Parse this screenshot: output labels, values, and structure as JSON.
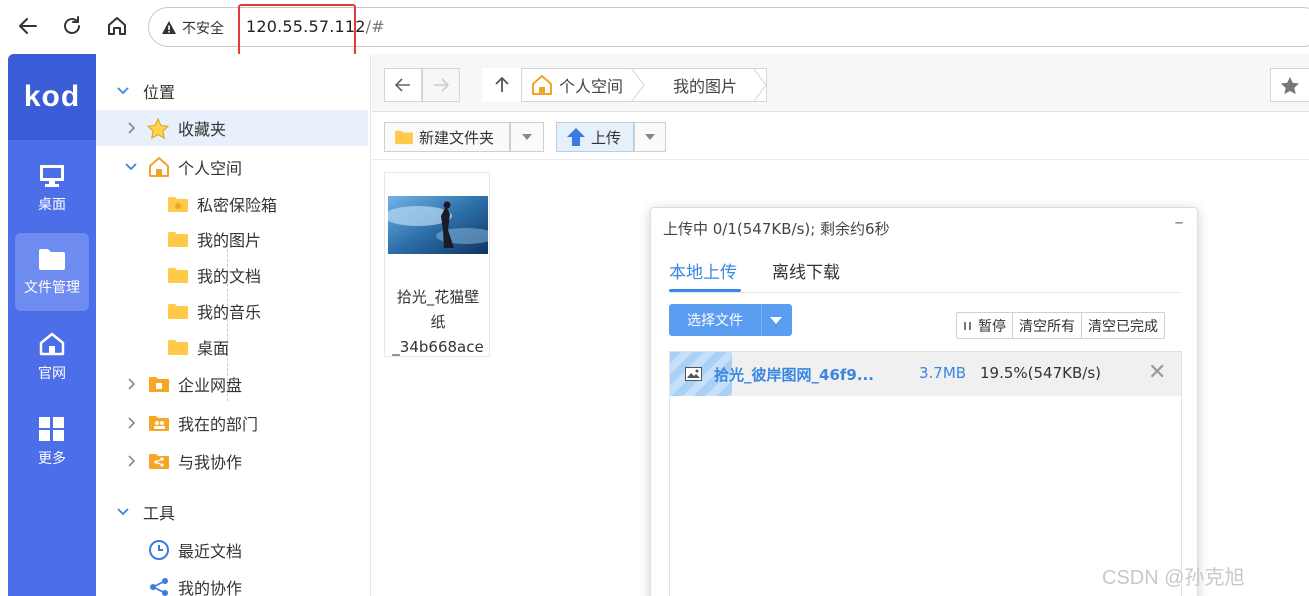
{
  "browser": {
    "insecure_label": "不安全",
    "url_host": "120.55.57.112",
    "url_suffix": "/#"
  },
  "rail": {
    "logo": "kod",
    "items": [
      {
        "label": "桌面",
        "icon": "monitor-icon"
      },
      {
        "label": "文件管理",
        "icon": "folder-icon",
        "active": true
      },
      {
        "label": "官网",
        "icon": "home-icon"
      },
      {
        "label": "更多",
        "icon": "grid-icon"
      }
    ]
  },
  "tree": {
    "section_location": "位置",
    "favorites": "收藏夹",
    "personal_space": "个人空间",
    "children": [
      "私密保险箱",
      "我的图片",
      "我的文档",
      "我的音乐",
      "桌面"
    ],
    "enterprise_disk": "企业网盘",
    "my_department": "我在的部门",
    "collaborate_with_me": "与我协作",
    "section_tools": "工具",
    "recent_docs": "最近文档",
    "my_collab": "我的协作"
  },
  "main": {
    "breadcrumb": [
      "个人空间",
      "我的图片"
    ],
    "new_folder": "新建文件夹",
    "upload": "上传",
    "file": {
      "name_lines": [
        "拾光_花猫壁",
        "纸",
        "_34b668ace"
      ]
    }
  },
  "dialog": {
    "title": "上传中 0/1(547KB/s); 剩余约6秒",
    "minimize": "–",
    "tab_local": "本地上传",
    "tab_offline": "离线下载",
    "select_file": "选择文件",
    "pause": "暂停",
    "clear_all": "清空所有",
    "clear_done": "清空已完成",
    "item": {
      "name": "拾光_彼岸图网_46f9...",
      "size": "3.7MB",
      "progress_text": "19.5%(547KB/s)",
      "progress": 0.195
    }
  },
  "colors": {
    "rail": "#4c6ee8",
    "accent": "#3b86e0",
    "highlight_box": "#e23b3b"
  },
  "watermark": "CSDN @孙克旭"
}
